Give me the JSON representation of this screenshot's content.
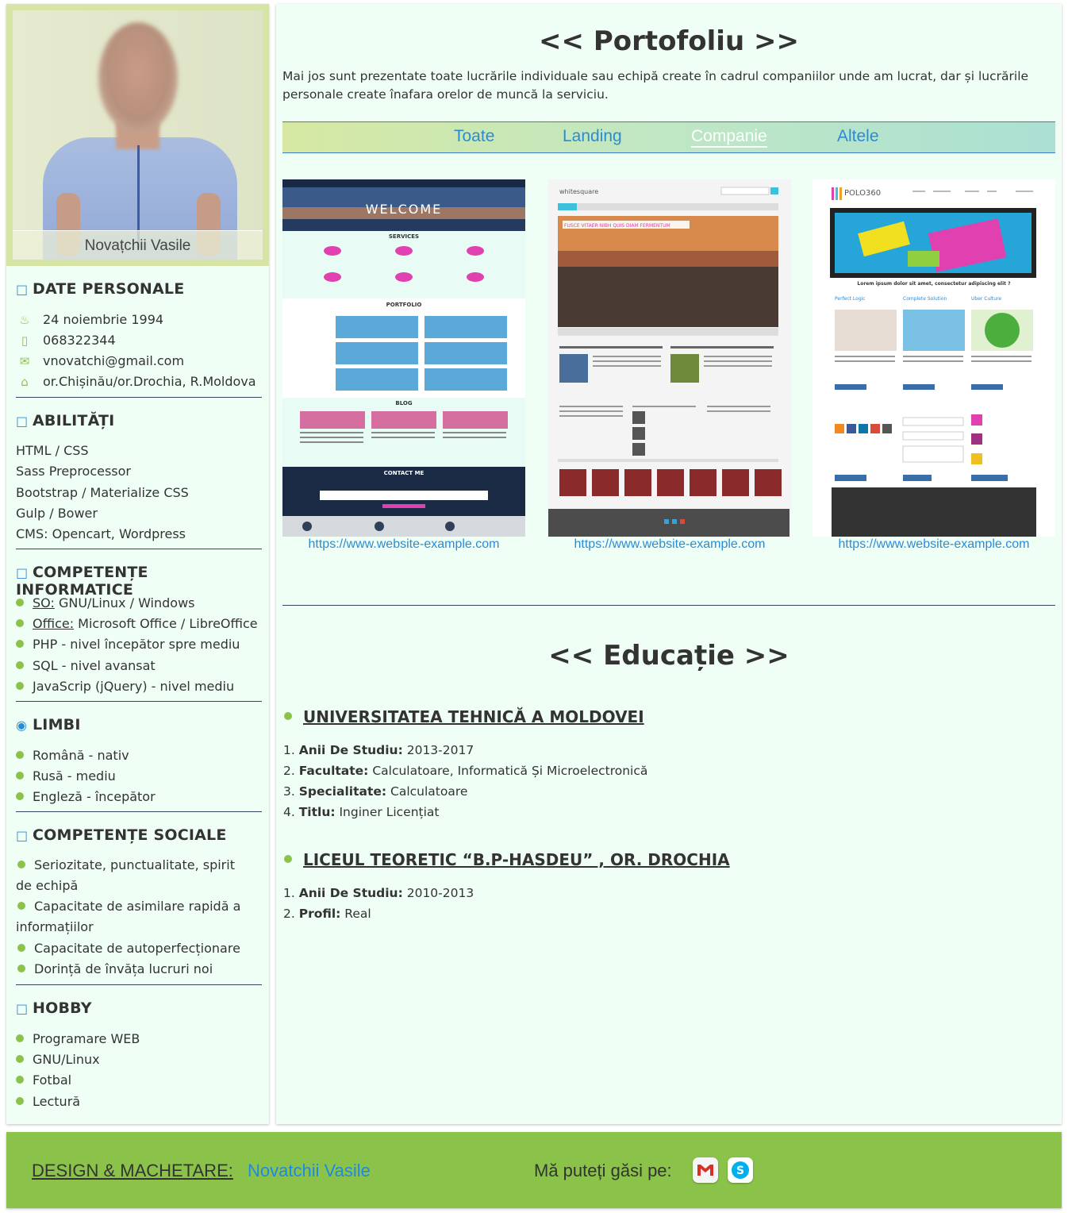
{
  "profile": {
    "name": "Novațchii Vasile"
  },
  "personal": {
    "title": "DATE PERSONALE",
    "birthday": "24 noiembrie 1994",
    "phone": "068322344",
    "email": "vnovatchi@gmail.com",
    "address": "or.Chișinău/or.Drochia, R.Moldova",
    "icons": [
      "cake-icon",
      "phone-icon",
      "mail-icon",
      "home-icon"
    ]
  },
  "skills": {
    "title": "ABILITĂȚI",
    "items": [
      "HTML / CSS",
      "Sass Preprocessor",
      "Bootstrap / Materialize CSS",
      "Gulp / Bower",
      "CMS: Opencart, Wordpress"
    ]
  },
  "it": {
    "title": "COMPETENȚE INFORMATICE",
    "items": [
      {
        "label": "SO:",
        "value": " GNU/Linux / Windows"
      },
      {
        "label": "Office:",
        "value": " Microsoft Office / LibreOffice"
      },
      {
        "label": "",
        "value": "PHP - nivel începător spre mediu"
      },
      {
        "label": "",
        "value": "SQL - nivel avansat"
      },
      {
        "label": "",
        "value": "JavaScrip (jQuery) - nivel mediu"
      }
    ]
  },
  "languages": {
    "title": "LIMBI",
    "items": [
      "Română - nativ",
      "Rusă - mediu",
      "Engleză - începător"
    ]
  },
  "social": {
    "title": "COMPETENȚE SOCIALE",
    "items": [
      "Seriozitate, punctualitate, spirit de echipă",
      "Capacitate de asimilare rapidă a informațiilor",
      "Capacitate de autoperfecționare",
      "Dorință de învăța lucruri noi"
    ]
  },
  "hobby": {
    "title": "HOBBY",
    "items": [
      "Programare WEB",
      "GNU/Linux",
      "Fotbal",
      "Lectură"
    ]
  },
  "portfolio": {
    "title": "<< Portofoliu >>",
    "intro": "Mai jos sunt prezentate toate lucrările individuale sau echipă create în cadrul companiilor unde am lucrat, dar și lucrările personale create înafara orelor de muncă la serviciu.",
    "filters": [
      "Toate",
      "Landing",
      "Companie",
      "Altele"
    ],
    "active_filter": "Companie",
    "projects": [
      {
        "link": "https://www.website-example.com",
        "banner": "WELCOME",
        "s1": "SERVICES",
        "s2": "PORTFOLIO",
        "s3": "BLOG",
        "s4": "CONTACT ME"
      },
      {
        "link": "https://www.website-example.com",
        "brand": "whitesquare",
        "hero": "FUSCE VITAER NIBH QUIS DIAM FERMENTUM"
      },
      {
        "link": "https://www.website-example.com",
        "brand": "POLO360",
        "lead": "Lorem ipsum dolor sit amet, consectetur adipiscing elit ?",
        "cols": [
          "Perfect Logic",
          "Complete Solution",
          "Uber Culture"
        ]
      }
    ]
  },
  "education": {
    "title": "<< Educație >>",
    "schools": [
      {
        "name": "UNIVERSITATEA TEHNICĂ A MOLDOVEI",
        "lines": [
          {
            "num": "1. ",
            "k": "Anii De Studiu:",
            "v": " 2013-2017"
          },
          {
            "num": "2. ",
            "k": "Facultate:",
            "v": " Calculatoare, Informatică Și Microelectronică"
          },
          {
            "num": "3. ",
            "k": "Specialitate:",
            "v": " Calculatoare"
          },
          {
            "num": "4. ",
            "k": "Titlu:",
            "v": " Inginer Licențiat"
          }
        ]
      },
      {
        "name": "LICEUL TEORETIC “B.P-HASDEU” , OR. DROCHIA",
        "lines": [
          {
            "num": "1. ",
            "k": "Anii De Studiu:",
            "v": " 2010-2013"
          },
          {
            "num": "2. ",
            "k": "Profil:",
            "v": " Real"
          }
        ]
      }
    ]
  },
  "footer": {
    "label": "DESIGN & MACHETARE:",
    "author": "Novatchii Vasile",
    "find": "Mă puteți găsi pe:",
    "icons": [
      "gmail-icon",
      "skype-icon"
    ]
  },
  "colors": {
    "accent_green": "#8bc34a",
    "link_blue": "#2a8bd6",
    "panel_bg": "#f0fff5"
  }
}
